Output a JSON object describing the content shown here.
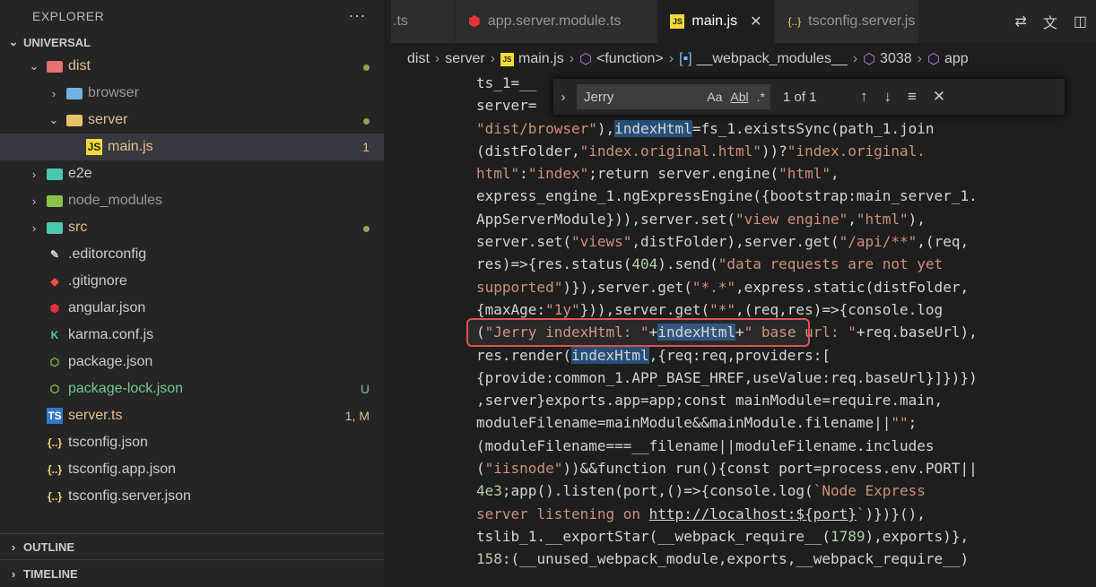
{
  "sidebar": {
    "title": "EXPLORER",
    "more": "···",
    "project": "UNIVERSAL",
    "outline": "OUTLINE",
    "timeline": "TIMELINE",
    "items": [
      {
        "label": "dist",
        "badge": "•",
        "status": "modified"
      },
      {
        "label": "browser",
        "badge": "",
        "status": ""
      },
      {
        "label": "server",
        "badge": "•",
        "status": "modified"
      },
      {
        "label": "main.js",
        "badge": "1",
        "status": "modified"
      },
      {
        "label": "e2e",
        "badge": "",
        "status": ""
      },
      {
        "label": "node_modules",
        "badge": "",
        "status": ""
      },
      {
        "label": "src",
        "badge": "•",
        "status": "modified"
      },
      {
        "label": ".editorconfig",
        "badge": "",
        "status": ""
      },
      {
        "label": ".gitignore",
        "badge": "",
        "status": ""
      },
      {
        "label": "angular.json",
        "badge": "",
        "status": ""
      },
      {
        "label": "karma.conf.js",
        "badge": "",
        "status": ""
      },
      {
        "label": "package.json",
        "badge": "",
        "status": ""
      },
      {
        "label": "package-lock.json",
        "badge": "U",
        "status": "untracked"
      },
      {
        "label": "server.ts",
        "badge": "1, M",
        "status": "modified"
      },
      {
        "label": "tsconfig.json",
        "badge": "",
        "status": ""
      },
      {
        "label": "tsconfig.app.json",
        "badge": "",
        "status": ""
      },
      {
        "label": "tsconfig.server.json",
        "badge": "",
        "status": ""
      }
    ]
  },
  "tabs": {
    "items": [
      {
        "label": ".ts"
      },
      {
        "label": "app.server.module.ts"
      },
      {
        "label": "main.js",
        "close": "✕"
      },
      {
        "label": "tsconfig.server.js"
      }
    ]
  },
  "breadcrumbs": [
    "dist",
    "server",
    "main.js",
    "<function>",
    "__webpack_modules__",
    "3038",
    "app"
  ],
  "find": {
    "value": "Jerry",
    "match_case": "Aa",
    "whole_word": "Abl",
    "regex": ".*",
    "count": "1 of 1"
  },
  "colors": {
    "accent": "#007acc",
    "highlight_box": "#e05050",
    "modified": "#e2c08d",
    "untracked": "#73c991"
  }
}
